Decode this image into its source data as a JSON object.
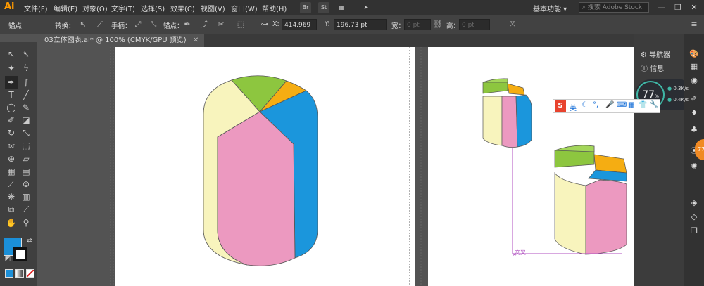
{
  "app": {
    "logo": "Ai"
  },
  "menu": [
    "文件(F)",
    "编辑(E)",
    "对象(O)",
    "文字(T)",
    "选择(S)",
    "效果(C)",
    "视图(V)",
    "窗口(W)",
    "帮助(H)"
  ],
  "toolbar_icons": {
    "br": "Br",
    "st": "St"
  },
  "workspace": "基本功能",
  "search": {
    "placeholder": "搜索 Adobe Stock"
  },
  "control": {
    "anchor_label": "锚点",
    "convert_label": "转换：",
    "handles_label": "手柄：",
    "anchors_label": "锚点：",
    "x_label": "X:",
    "x_value": "414.969",
    "y_label": "Y:",
    "y_value": "196.73 pt",
    "width_label": "宽：",
    "width_value": "0 pt",
    "height_label": "高：",
    "height_value": "0 pt"
  },
  "document": {
    "tab_title": "03立体图表.ai* @ 100% (CMYK/GPU 预览)"
  },
  "right_panel": {
    "items": [
      "导航器",
      "信息"
    ]
  },
  "network": {
    "percent": "77",
    "percent_unit": "%",
    "up": "0.3K/s",
    "down": "0.4K/s"
  },
  "ime": {
    "lang": "英"
  },
  "edge_badge": "77",
  "smart_guide": "交叉",
  "colors": {
    "fill": "#1b8fd8",
    "pie_pink": "#ec99c0",
    "pie_blue": "#1b96dc",
    "pie_green": "#8dc63f",
    "pie_yellow": "#f8f4bd",
    "pie_orange": "#f5ad12",
    "guide": "#b050c0"
  }
}
